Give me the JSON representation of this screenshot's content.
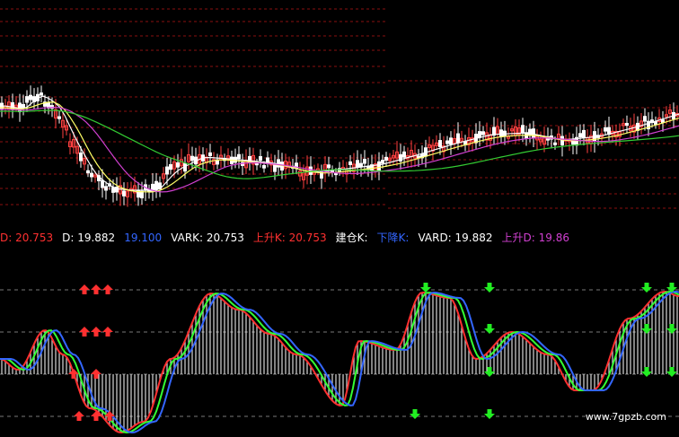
{
  "colors": {
    "background": "#000000",
    "grid": "#8a1010",
    "candle_up": "#ff4040",
    "candle_down": "#ffffff",
    "ma_fast": "#ffffff",
    "ma_mid": "#ffff66",
    "ma_slow": "#d040d0",
    "ma_long": "#33cc33",
    "osc_k": "#ff3030",
    "osc_d": "#33ff33",
    "osc_j": "#3366ff",
    "up_arrow": "#ff3030",
    "down_arrow": "#22ee22",
    "volume_bar": "#ffffff"
  },
  "indicator_legend": [
    {
      "text": "D: 20.753",
      "color": "#ff3030"
    },
    {
      "text": "D: 19.882",
      "color": "#ffffff"
    },
    {
      "text": "19.100",
      "color": "#3366ff"
    },
    {
      "text": "VARK: 20.753",
      "color": "#ffffff"
    },
    {
      "text": "上升K: 20.753",
      "color": "#ff3030"
    },
    {
      "text": "建仓K:",
      "color": "#ffffff"
    },
    {
      "text": "下降K:",
      "color": "#3366ff"
    },
    {
      "text": "VARD: 19.882",
      "color": "#ffffff"
    },
    {
      "text": "上升D: 19.86",
      "color": "#d040d0"
    }
  ],
  "watermark": "www.7gpzb.com",
  "icons": {
    "buy_signal": "up-arrow-icon",
    "sell_signal": "down-arrow-icon"
  }
}
